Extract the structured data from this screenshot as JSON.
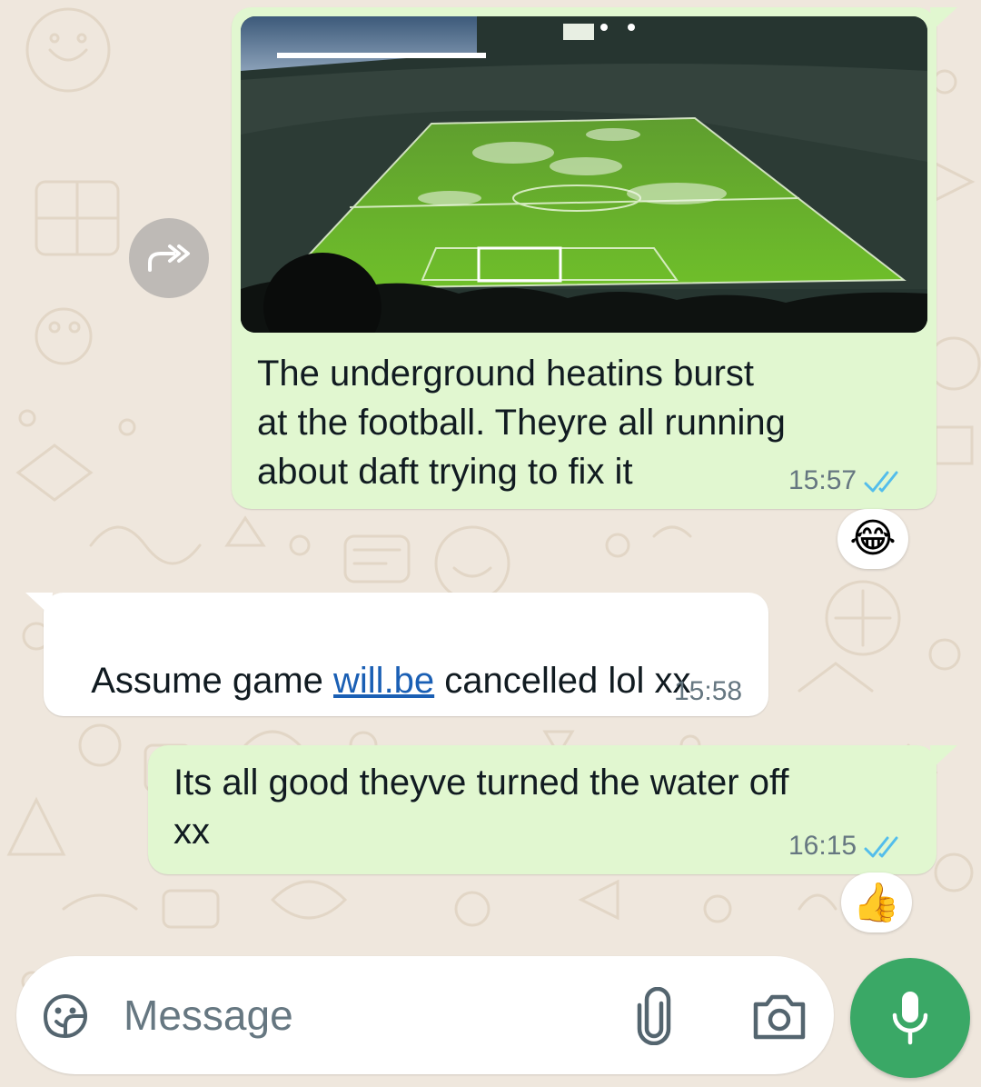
{
  "messages": [
    {
      "direction": "outgoing",
      "type": "image",
      "caption": "The underground heatins burst\nat the football. Theyre all running\nabout daft trying to fix it",
      "time": "15:57",
      "status": "read",
      "reaction": "😂"
    },
    {
      "direction": "incoming",
      "type": "text",
      "text_before": "Assume game ",
      "link": "will.be",
      "text_after": " cancelled lol xx",
      "time": "15:58"
    },
    {
      "direction": "outgoing",
      "type": "text",
      "text": "Its all good theyve turned the water off\nxx",
      "time": "16:15",
      "status": "read",
      "reaction": "👍"
    }
  ],
  "composer": {
    "placeholder": "Message",
    "icons": [
      "sticker-icon",
      "attach-icon",
      "camera-icon",
      "mic-icon"
    ]
  },
  "forward_icon": "forward-icon",
  "colors": {
    "outgoing_bubble": "#e1f7d0",
    "incoming_bubble": "#ffffff",
    "chat_background": "#efe7dd",
    "read_ticks": "#53bdeb",
    "mic_button": "#3aa866",
    "link": "#1a5fb4"
  }
}
